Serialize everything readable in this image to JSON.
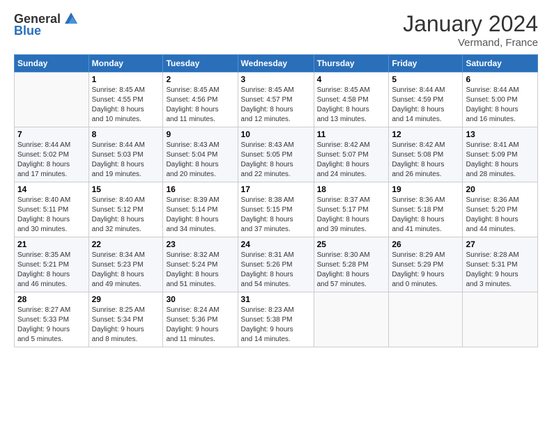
{
  "header": {
    "logo_general": "General",
    "logo_blue": "Blue",
    "month_year": "January 2024",
    "location": "Vermand, France"
  },
  "weekdays": [
    "Sunday",
    "Monday",
    "Tuesday",
    "Wednesday",
    "Thursday",
    "Friday",
    "Saturday"
  ],
  "weeks": [
    [
      {
        "day": "",
        "info": ""
      },
      {
        "day": "1",
        "info": "Sunrise: 8:45 AM\nSunset: 4:55 PM\nDaylight: 8 hours\nand 10 minutes."
      },
      {
        "day": "2",
        "info": "Sunrise: 8:45 AM\nSunset: 4:56 PM\nDaylight: 8 hours\nand 11 minutes."
      },
      {
        "day": "3",
        "info": "Sunrise: 8:45 AM\nSunset: 4:57 PM\nDaylight: 8 hours\nand 12 minutes."
      },
      {
        "day": "4",
        "info": "Sunrise: 8:45 AM\nSunset: 4:58 PM\nDaylight: 8 hours\nand 13 minutes."
      },
      {
        "day": "5",
        "info": "Sunrise: 8:44 AM\nSunset: 4:59 PM\nDaylight: 8 hours\nand 14 minutes."
      },
      {
        "day": "6",
        "info": "Sunrise: 8:44 AM\nSunset: 5:00 PM\nDaylight: 8 hours\nand 16 minutes."
      }
    ],
    [
      {
        "day": "7",
        "info": "Sunrise: 8:44 AM\nSunset: 5:02 PM\nDaylight: 8 hours\nand 17 minutes."
      },
      {
        "day": "8",
        "info": "Sunrise: 8:44 AM\nSunset: 5:03 PM\nDaylight: 8 hours\nand 19 minutes."
      },
      {
        "day": "9",
        "info": "Sunrise: 8:43 AM\nSunset: 5:04 PM\nDaylight: 8 hours\nand 20 minutes."
      },
      {
        "day": "10",
        "info": "Sunrise: 8:43 AM\nSunset: 5:05 PM\nDaylight: 8 hours\nand 22 minutes."
      },
      {
        "day": "11",
        "info": "Sunrise: 8:42 AM\nSunset: 5:07 PM\nDaylight: 8 hours\nand 24 minutes."
      },
      {
        "day": "12",
        "info": "Sunrise: 8:42 AM\nSunset: 5:08 PM\nDaylight: 8 hours\nand 26 minutes."
      },
      {
        "day": "13",
        "info": "Sunrise: 8:41 AM\nSunset: 5:09 PM\nDaylight: 8 hours\nand 28 minutes."
      }
    ],
    [
      {
        "day": "14",
        "info": "Sunrise: 8:40 AM\nSunset: 5:11 PM\nDaylight: 8 hours\nand 30 minutes."
      },
      {
        "day": "15",
        "info": "Sunrise: 8:40 AM\nSunset: 5:12 PM\nDaylight: 8 hours\nand 32 minutes."
      },
      {
        "day": "16",
        "info": "Sunrise: 8:39 AM\nSunset: 5:14 PM\nDaylight: 8 hours\nand 34 minutes."
      },
      {
        "day": "17",
        "info": "Sunrise: 8:38 AM\nSunset: 5:15 PM\nDaylight: 8 hours\nand 37 minutes."
      },
      {
        "day": "18",
        "info": "Sunrise: 8:37 AM\nSunset: 5:17 PM\nDaylight: 8 hours\nand 39 minutes."
      },
      {
        "day": "19",
        "info": "Sunrise: 8:36 AM\nSunset: 5:18 PM\nDaylight: 8 hours\nand 41 minutes."
      },
      {
        "day": "20",
        "info": "Sunrise: 8:36 AM\nSunset: 5:20 PM\nDaylight: 8 hours\nand 44 minutes."
      }
    ],
    [
      {
        "day": "21",
        "info": "Sunrise: 8:35 AM\nSunset: 5:21 PM\nDaylight: 8 hours\nand 46 minutes."
      },
      {
        "day": "22",
        "info": "Sunrise: 8:34 AM\nSunset: 5:23 PM\nDaylight: 8 hours\nand 49 minutes."
      },
      {
        "day": "23",
        "info": "Sunrise: 8:32 AM\nSunset: 5:24 PM\nDaylight: 8 hours\nand 51 minutes."
      },
      {
        "day": "24",
        "info": "Sunrise: 8:31 AM\nSunset: 5:26 PM\nDaylight: 8 hours\nand 54 minutes."
      },
      {
        "day": "25",
        "info": "Sunrise: 8:30 AM\nSunset: 5:28 PM\nDaylight: 8 hours\nand 57 minutes."
      },
      {
        "day": "26",
        "info": "Sunrise: 8:29 AM\nSunset: 5:29 PM\nDaylight: 9 hours\nand 0 minutes."
      },
      {
        "day": "27",
        "info": "Sunrise: 8:28 AM\nSunset: 5:31 PM\nDaylight: 9 hours\nand 3 minutes."
      }
    ],
    [
      {
        "day": "28",
        "info": "Sunrise: 8:27 AM\nSunset: 5:33 PM\nDaylight: 9 hours\nand 5 minutes."
      },
      {
        "day": "29",
        "info": "Sunrise: 8:25 AM\nSunset: 5:34 PM\nDaylight: 9 hours\nand 8 minutes."
      },
      {
        "day": "30",
        "info": "Sunrise: 8:24 AM\nSunset: 5:36 PM\nDaylight: 9 hours\nand 11 minutes."
      },
      {
        "day": "31",
        "info": "Sunrise: 8:23 AM\nSunset: 5:38 PM\nDaylight: 9 hours\nand 14 minutes."
      },
      {
        "day": "",
        "info": ""
      },
      {
        "day": "",
        "info": ""
      },
      {
        "day": "",
        "info": ""
      }
    ]
  ]
}
